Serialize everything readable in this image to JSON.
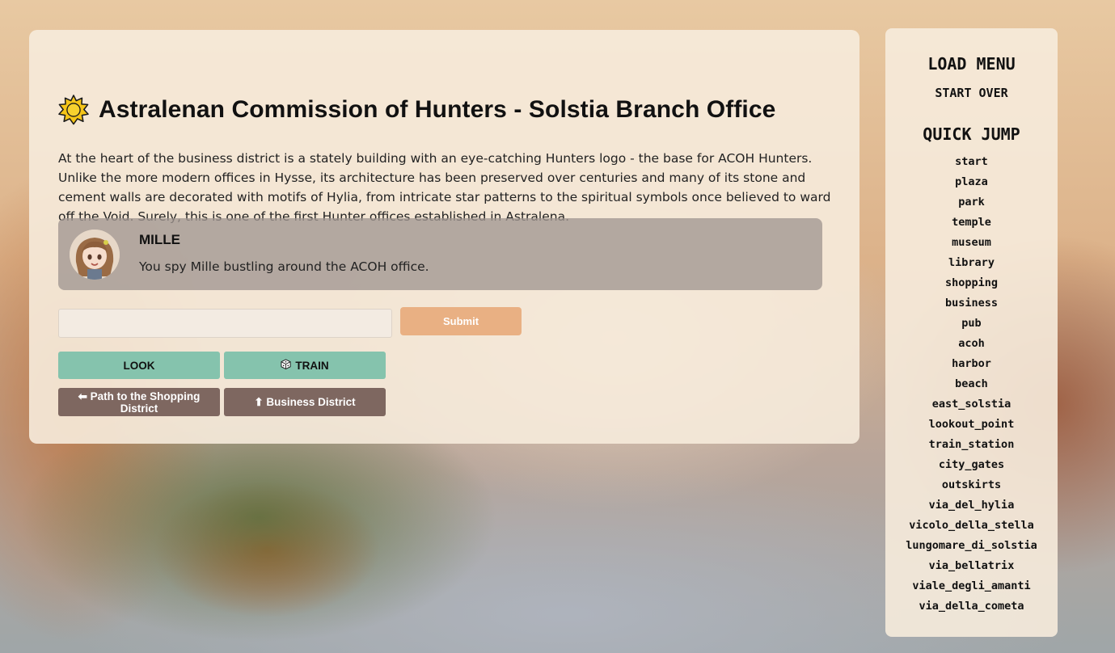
{
  "main": {
    "title": "Astralenan Commission of Hunters - Solstia Branch Office",
    "description": "At the heart of the business district is a stately building with an eye-catching Hunters logo - the base for ACOH Hunters. Unlike the more modern offices in Hysse, its architecture has been preserved over centuries and many of its stone and cement walls are decorated with motifs of Hylia, from intricate star patterns to the spiritual symbols once believed to ward off the Void. Surely, this is one of the first Hunter offices established in Astralena.",
    "npc": {
      "name": "MILLE",
      "text": "You spy Mille bustling around the ACOH office."
    },
    "input": {
      "value": "",
      "placeholder": ""
    },
    "submit_label": "Submit",
    "actions": {
      "look": "LOOK",
      "train": "TRAIN",
      "path_shopping": "⬅ Path to the Shopping District",
      "business_district": "⬆ Business District"
    }
  },
  "sidebar": {
    "load_menu": "LOAD MENU",
    "start_over": "START OVER",
    "quick_jump": "QUICK JUMP",
    "items": [
      "start",
      "plaza",
      "park",
      "temple",
      "museum",
      "library",
      "shopping",
      "business",
      "pub",
      "acoh",
      "harbor",
      "beach",
      "east_solstia",
      "lookout_point",
      "train_station",
      "city_gates",
      "outskirts",
      "via_del_hylia",
      "vicolo_della_stella",
      "lungomare_di_solstia",
      "via_bellatrix",
      "viale_degli_amanti",
      "via_della_cometa"
    ]
  },
  "colors": {
    "panel_bg": "#f6ebdc",
    "npc_box": "#a09691",
    "submit": "#e9b083",
    "teal_button": "#85c3ad",
    "brown_button": "#7e6760"
  },
  "icons": {
    "title": "sun-icon",
    "train": "dice-icon",
    "avatar": "mille-avatar"
  }
}
